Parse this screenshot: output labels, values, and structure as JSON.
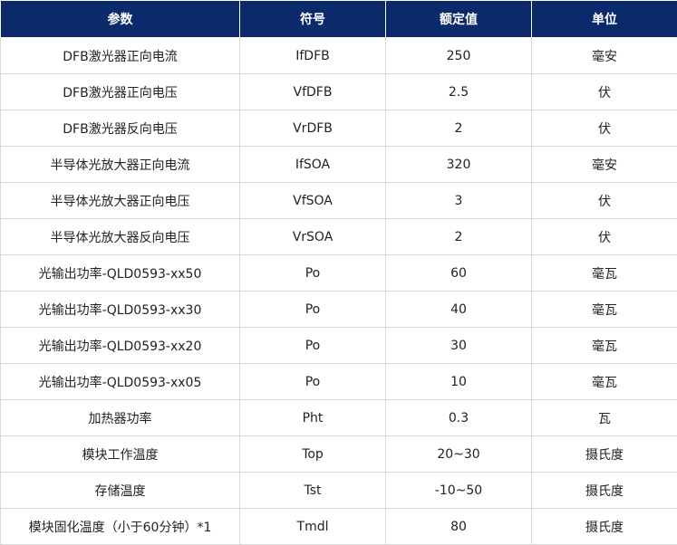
{
  "table": {
    "headers": [
      "参数",
      "符号",
      "额定值",
      "单位"
    ],
    "rows": [
      [
        "DFB激光器正向电流",
        "IfDFB",
        "250",
        "毫安"
      ],
      [
        "DFB激光器正向电压",
        "VfDFB",
        "2.5",
        "伏"
      ],
      [
        "DFB激光器反向电压",
        "VrDFB",
        "2",
        "伏"
      ],
      [
        "半导体光放大器正向电流",
        "IfSOA",
        "320",
        "毫安"
      ],
      [
        "半导体光放大器正向电压",
        "VfSOA",
        "3",
        "伏"
      ],
      [
        "半导体光放大器反向电压",
        "VrSOA",
        "2",
        "伏"
      ],
      [
        "光输出功率-QLD0593-xx50",
        "Po",
        "60",
        "毫瓦"
      ],
      [
        "光输出功率-QLD0593-xx30",
        "Po",
        "40",
        "毫瓦"
      ],
      [
        "光输出功率-QLD0593-xx20",
        "Po",
        "30",
        "毫瓦"
      ],
      [
        "光输出功率-QLD0593-xx05",
        "Po",
        "10",
        "毫瓦"
      ],
      [
        "加热器功率",
        "Pht",
        "0.3",
        "瓦"
      ],
      [
        "模块工作温度",
        "Top",
        "20~30",
        "摄氏度"
      ],
      [
        "存储温度",
        "Tst",
        "-10~50",
        "摄氏度"
      ],
      [
        "模块固化温度（小于60分钟）*1",
        "Tmdl",
        "80",
        "摄氏度"
      ]
    ]
  },
  "colors": {
    "header_bg": "#0b2a6b",
    "header_text": "#ffffff",
    "border": "#d9d9d9"
  }
}
